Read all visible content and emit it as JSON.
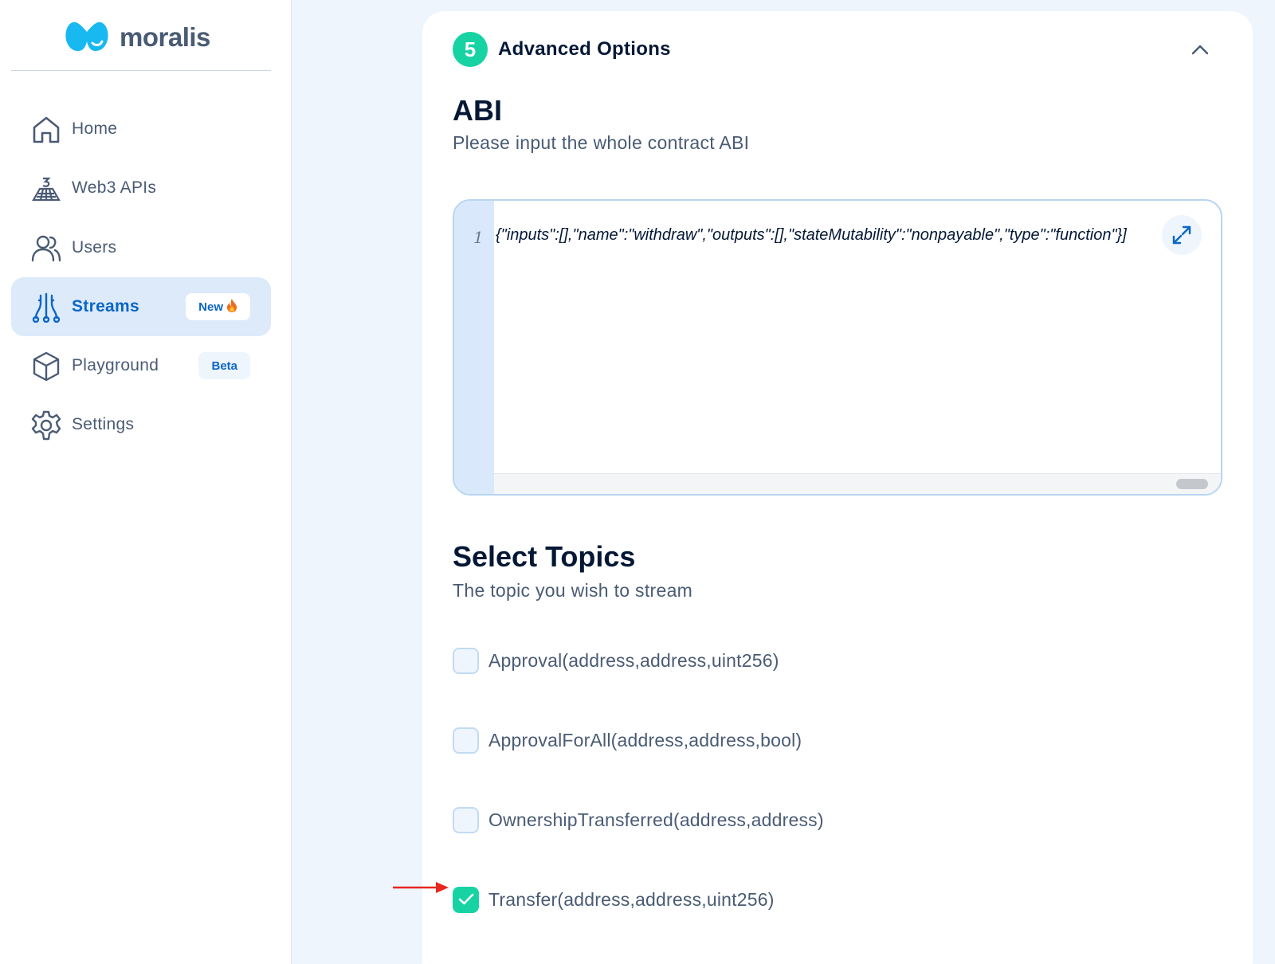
{
  "brand": {
    "name": "moralis"
  },
  "sidebar": {
    "items": [
      {
        "label": "Home",
        "icon": "home-icon",
        "active": false
      },
      {
        "label": "Web3 APIs",
        "icon": "web3-apis-icon",
        "active": false
      },
      {
        "label": "Users",
        "icon": "users-icon",
        "active": false
      },
      {
        "label": "Streams",
        "icon": "streams-icon",
        "active": true,
        "badge": "New",
        "badge_icon": "fire-icon"
      },
      {
        "label": "Playground",
        "icon": "cube-icon",
        "active": false,
        "badge": "Beta"
      },
      {
        "label": "Settings",
        "icon": "gear-icon",
        "active": false
      }
    ]
  },
  "advanced": {
    "step": "5",
    "title": "Advanced Options",
    "abi": {
      "heading": "ABI",
      "subtitle": "Please input the whole contract ABI",
      "line_number": "1",
      "code": "{\"inputs\":[],\"name\":\"withdraw\",\"outputs\":[],\"stateMutability\":\"nonpayable\",\"type\":\"function\"}]"
    },
    "topics": {
      "heading": "Select Topics",
      "subtitle": "The topic you wish to stream",
      "items": [
        {
          "label": "Approval(address,address,uint256)",
          "checked": false
        },
        {
          "label": "ApprovalForAll(address,address,bool)",
          "checked": false
        },
        {
          "label": "OwnershipTransferred(address,address)",
          "checked": false
        },
        {
          "label": "Transfer(address,address,uint256)",
          "checked": true
        }
      ]
    }
  },
  "colors": {
    "accent": "#0b66c7",
    "success": "#17d3a4",
    "arrow": "#e5281d"
  }
}
